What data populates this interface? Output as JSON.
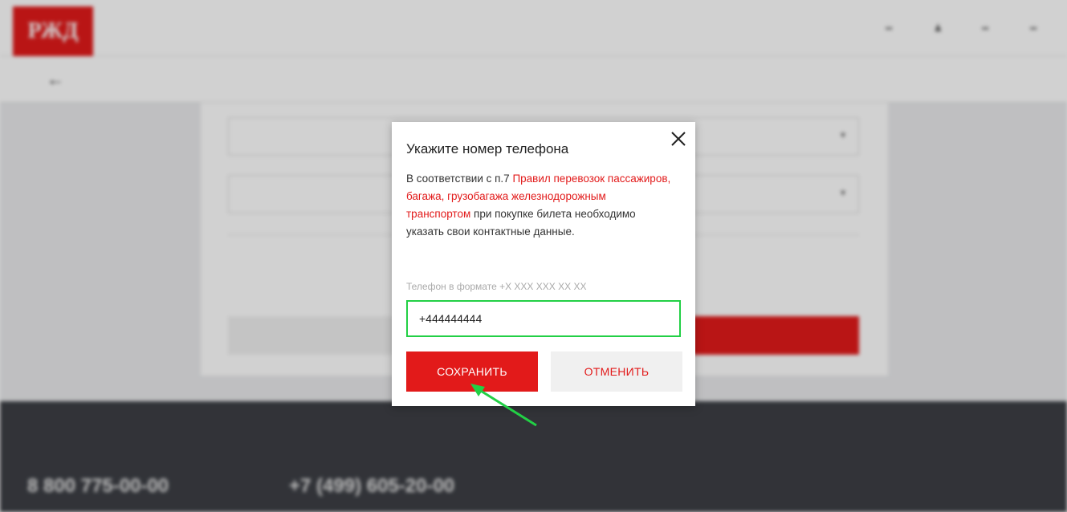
{
  "header": {
    "logo_text": "РЖД",
    "icons": [
      "menu-icon",
      "user-icon",
      "lang-icon",
      "points-icon"
    ],
    "back_icon": "arrow-left-icon"
  },
  "background": {
    "select_1": "",
    "select_2": "",
    "route_text": "",
    "button_left": "",
    "button_right": ""
  },
  "footer": {
    "phone_1": "8 800 775-00-00",
    "phone_2": "+7 (499) 605-20-00"
  },
  "modal": {
    "title": "Укажите номер телефона",
    "text_prefix": "В соответствии с п.7 ",
    "text_link": "Правил перевозок пассажиров, багажа, грузобагажа железнодорожным транспортом",
    "text_suffix": " при покупке билета необходимо указать свои контактные данные.",
    "phone_hint": "Телефон в формате +Х ХХХ ХХХ ХХ ХХ",
    "phone_value": "+444444444",
    "save_label": "СОХРАНИТЬ",
    "cancel_label": "ОТМЕНИТЬ",
    "close_icon": "close-icon"
  },
  "colors": {
    "brand": "#e21a1a",
    "highlight": "#22d045",
    "footer": "#3d3f45"
  }
}
